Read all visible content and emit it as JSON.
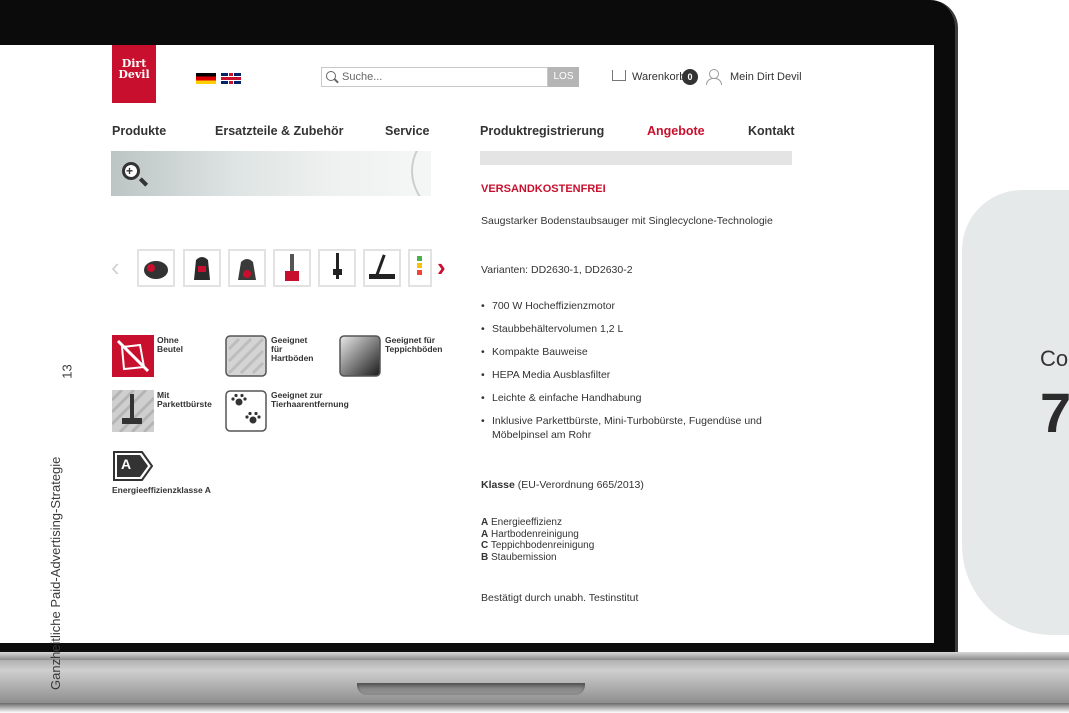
{
  "side": {
    "page_number": "13",
    "running_title": "Ganzheitliche Paid-Advertising-Strategie"
  },
  "blob": {
    "label": "Co",
    "number": "7"
  },
  "header": {
    "logo_text": "Dirt Devil",
    "search_placeholder": "Suche...",
    "search_button": "LOS",
    "cart_label": "Warenkorb",
    "cart_count": "0",
    "account_label": "Mein Dirt Devil"
  },
  "nav": {
    "items": [
      {
        "label": "Produkte"
      },
      {
        "label": "Ersatzteile & Zubehör"
      },
      {
        "label": "Service"
      },
      {
        "label": "Produktregistrierung"
      },
      {
        "label": "Angebote"
      },
      {
        "label": "Kontakt"
      }
    ]
  },
  "product": {
    "promo": "VERSANDKOSTENFREI",
    "tagline": "Saugstarker Bodenstaubsauger mit Singlecyclone-Technologie",
    "variants": "Varianten: DD2630-1, DD2630-2",
    "features": [
      "700 W Hocheffizienzmotor",
      "Staubbehältervolumen 1,2 L",
      "Kompakte Bauweise",
      "HEPA Media Ausblasfilter",
      "Leichte & einfache Handhabung",
      "Inklusive Parkettbürste, Mini-Turbobürste, Fugendüse und Möbelpinsel am Rohr"
    ],
    "klasse_bold": "Klasse",
    "klasse_rest": " (EU-Verordnung 665/2013)",
    "energy": [
      {
        "grade": "A",
        "label": "Energieeffizienz"
      },
      {
        "grade": "A",
        "label": "Hartbodenreinigung"
      },
      {
        "grade": "C",
        "label": "Teppichbodenreinigung"
      },
      {
        "grade": "B",
        "label": "Staubemission"
      }
    ],
    "certified": "Bestätigt durch unabh. Testinstitut"
  },
  "icons": {
    "ohne_beutel": "Ohne Beutel",
    "hartboeden": "Geeignet für Hartböden",
    "teppich": "Geeignet für Teppichböden",
    "parkett": "Mit Parkettbürste",
    "tierhaar": "Geeignet zur Tierhaarentfernung",
    "energy_letter": "A",
    "energy_label": "Energieeffizienzklasse A"
  },
  "colors": {
    "brand_red": "#c8102e",
    "text": "#333333"
  }
}
